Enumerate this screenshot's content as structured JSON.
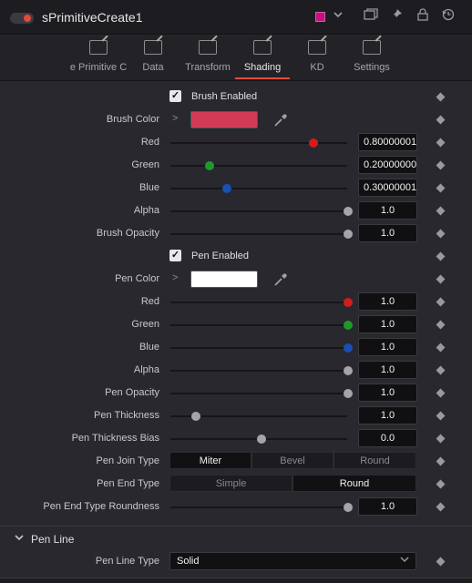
{
  "header": {
    "title": "sPrimitiveCreate1",
    "node_color": "#c0137e",
    "icons": [
      "toggle-switch",
      "color-swatch",
      "chevron-down-icon",
      "window-icon",
      "pin-icon",
      "lock-icon",
      "reset-icon"
    ]
  },
  "tabs": [
    {
      "label": "e Primitive C",
      "active": false
    },
    {
      "label": "Data",
      "active": false
    },
    {
      "label": "Transform",
      "active": false
    },
    {
      "label": "Shading",
      "active": true
    },
    {
      "label": "KD",
      "active": false
    },
    {
      "label": "Settings",
      "active": false
    }
  ],
  "brush": {
    "enabled_label": "Brush Enabled",
    "enabled": true,
    "color_label": "Brush Color",
    "color_value": "#d23b54",
    "red_label": "Red",
    "red_value": "0.80000001",
    "green_label": "Green",
    "green_value": "0.20000000",
    "blue_label": "Blue",
    "blue_value": "0.30000001",
    "alpha_label": "Alpha",
    "alpha_value": "1.0",
    "opacity_label": "Brush Opacity",
    "opacity_value": "1.0"
  },
  "pen": {
    "enabled_label": "Pen Enabled",
    "enabled": true,
    "color_label": "Pen Color",
    "color_value": "#ffffff",
    "red_label": "Red",
    "red_value": "1.0",
    "green_label": "Green",
    "green_value": "1.0",
    "blue_label": "Blue",
    "blue_value": "1.0",
    "alpha_label": "Alpha",
    "alpha_value": "1.0",
    "opacity_label": "Pen Opacity",
    "opacity_value": "1.0",
    "thickness_label": "Pen Thickness",
    "thickness_value": "1.0",
    "thickness_bias_label": "Pen Thickness Bias",
    "thickness_bias_value": "0.0",
    "join_type_label": "Pen Join Type",
    "join_options": [
      "Miter",
      "Bevel",
      "Round"
    ],
    "join_selected": "Miter",
    "end_type_label": "Pen End Type",
    "end_options": [
      "Simple",
      "Round"
    ],
    "end_selected": "Round",
    "end_roundness_label": "Pen End Type Roundness",
    "end_roundness_value": "1.0"
  },
  "pen_line": {
    "section_title": "Pen Line",
    "type_label": "Pen Line Type",
    "type_value": "Solid"
  },
  "slider_levels": {
    "brush_red": 0.8,
    "brush_green": 0.2,
    "brush_blue": 0.3,
    "brush_alpha": 1.0,
    "brush_opacity": 1.0,
    "pen_red": 1.0,
    "pen_green": 1.0,
    "pen_blue": 1.0,
    "pen_alpha": 1.0,
    "pen_opacity": 1.0,
    "pen_thickness": 0.12,
    "pen_thickness_bias": 0.5,
    "pen_end_roundness": 1.0
  },
  "thumb_colors": {
    "red": "#d41c1c",
    "green": "#1f9a2a",
    "blue": "#1a4fb3",
    "gray": "#a5a5a8"
  }
}
